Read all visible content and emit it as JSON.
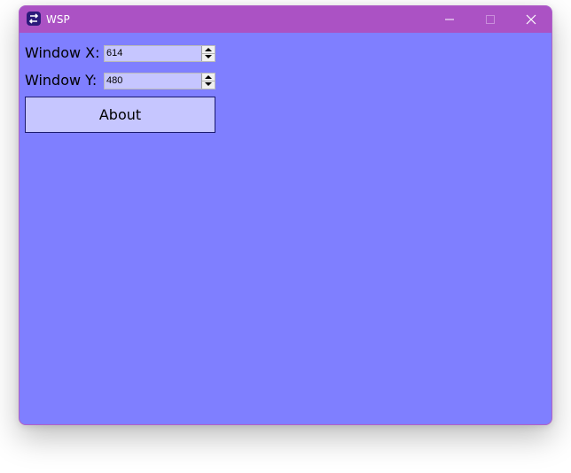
{
  "window": {
    "title": "WSP",
    "icon": "swap-arrows-icon",
    "title_bar_color": "#ab52c4",
    "background_color": "#7f7fff"
  },
  "title_bar_buttons": {
    "minimize": "minimize-icon",
    "maximize": "maximize-icon",
    "close": "close-icon"
  },
  "fields": [
    {
      "label": "Window X:",
      "value": "614"
    },
    {
      "label": "Window Y:",
      "value": "480"
    }
  ],
  "about_button": {
    "label": "About"
  }
}
